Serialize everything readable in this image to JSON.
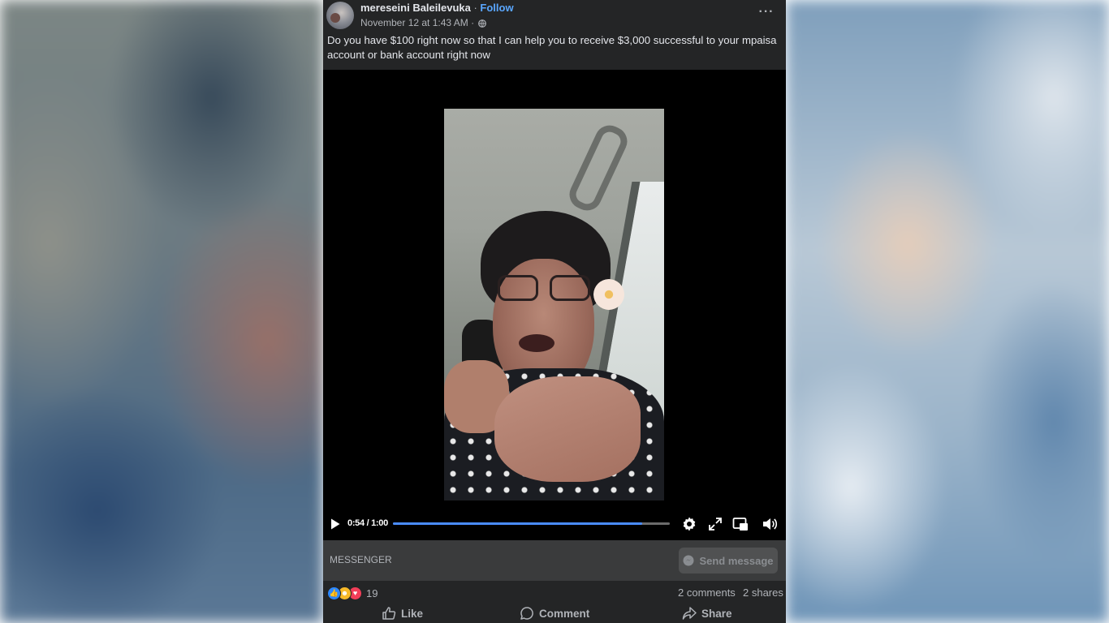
{
  "post": {
    "author_name": "mereseini Baleilevuka",
    "separator": " · ",
    "follow_label": "Follow",
    "timestamp": "November 12 at 1:43 AM",
    "meta_separator": " · ",
    "audience_icon": "globe-icon",
    "more_label": "···",
    "text": "Do you have $100 right now so that I can help you to receive $3,000 successful to your mpaisa account or bank account right now"
  },
  "video": {
    "time_display": "0:54 / 1:00",
    "progress": 0.9,
    "controls": [
      "play-icon",
      "settings-icon",
      "fullscreen-icon",
      "pip-icon",
      "volume-icon"
    ],
    "progress_color": "#4a8cff"
  },
  "messenger": {
    "label": "MESSENGER",
    "send_button_label": "Send message"
  },
  "reactions": {
    "icons": [
      "like-reaction-icon",
      "haha-reaction-icon",
      "love-reaction-icon"
    ],
    "count": "19",
    "comments": "2 comments",
    "shares": "2 shares"
  },
  "actions": {
    "like_label": "Like",
    "comment_label": "Comment",
    "share_label": "Share"
  }
}
